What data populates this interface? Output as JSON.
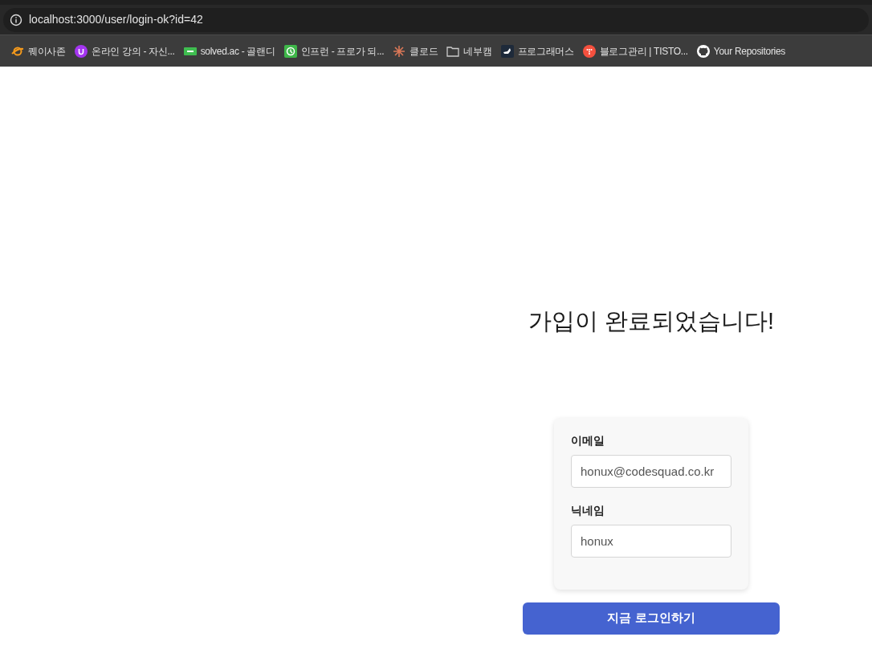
{
  "address_bar": {
    "url": "localhost:3000/user/login-ok?id=42"
  },
  "bookmarks": [
    {
      "label": "퀘이사존"
    },
    {
      "label": "온라인 강의 - 자신..."
    },
    {
      "label": "solved.ac - 골랜디"
    },
    {
      "label": "인프런 - 프로가 되..."
    },
    {
      "label": "클로드"
    },
    {
      "label": "네부캠"
    },
    {
      "label": "프로그래머스"
    },
    {
      "label": "블로그관리 | TISTO..."
    },
    {
      "label": "Your Repositories"
    }
  ],
  "heading": "가입이 완료되었습니다!",
  "form": {
    "fields": [
      {
        "label": "이메일",
        "value": "honux@codesquad.co.kr"
      },
      {
        "label": "닉네임",
        "value": "honux"
      }
    ]
  },
  "login_button": "지금 로그인하기"
}
